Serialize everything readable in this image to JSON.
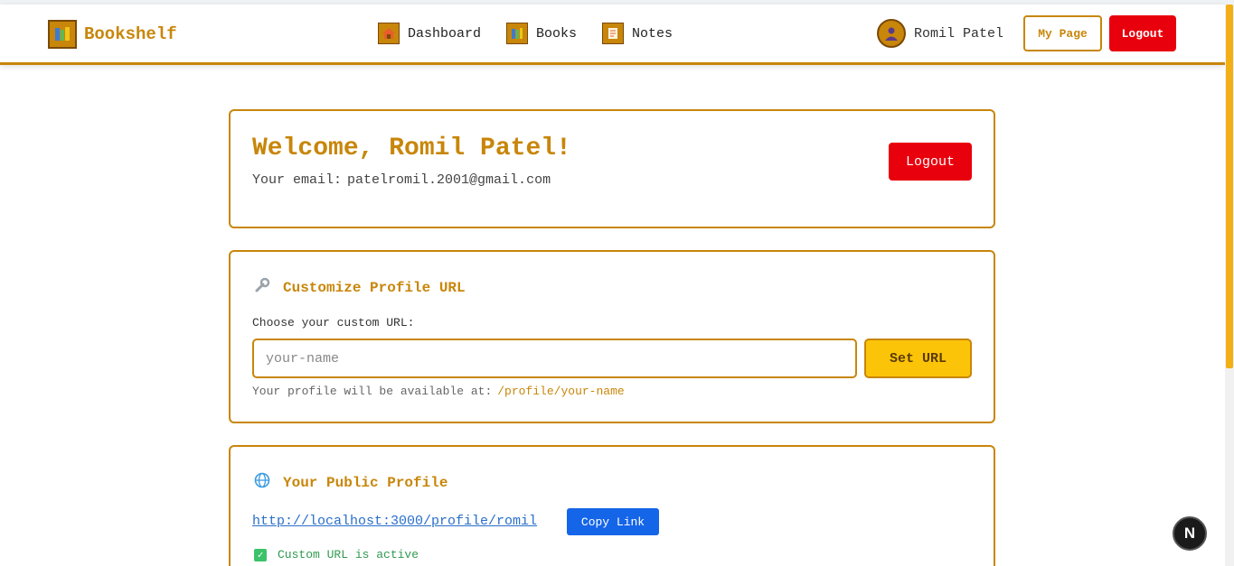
{
  "colors": {
    "accent": "#c8860a",
    "danger": "#e8000d",
    "primary": "#1565e8",
    "warning": "#fbc408",
    "success": "#3cc26a"
  },
  "navbar": {
    "brand": {
      "icon": "books-icon",
      "label": "Bookshelf"
    },
    "links": [
      {
        "icon": "house-icon",
        "label": "Dashboard"
      },
      {
        "icon": "books-icon",
        "label": "Books"
      },
      {
        "icon": "memo-icon",
        "label": "Notes"
      }
    ],
    "user": {
      "icon": "user-avatar-icon",
      "name": "Romil Patel"
    },
    "my_page_label": "My Page",
    "logout_label": "Logout"
  },
  "welcome": {
    "title": "Welcome, Romil Patel!",
    "email_label": "Your email:",
    "email": "patelromil.2001@gmail.com",
    "logout_label": "Logout"
  },
  "customize": {
    "icon": "wrench-icon",
    "title": "Customize Profile URL",
    "input_label": "Choose your custom URL:",
    "input_placeholder": "your-name",
    "input_value": "",
    "button_label": "Set URL",
    "hint_prefix": "Your profile will be available at:",
    "hint_path": "/profile/your-name"
  },
  "public_profile": {
    "icon": "globe-icon",
    "title": "Your Public Profile",
    "link": "http://localhost:3000/profile/romil",
    "copy_label": "Copy Link",
    "status_icon": "check-icon",
    "status_text": "Custom URL is active"
  },
  "dev_badge": {
    "label": "N"
  }
}
